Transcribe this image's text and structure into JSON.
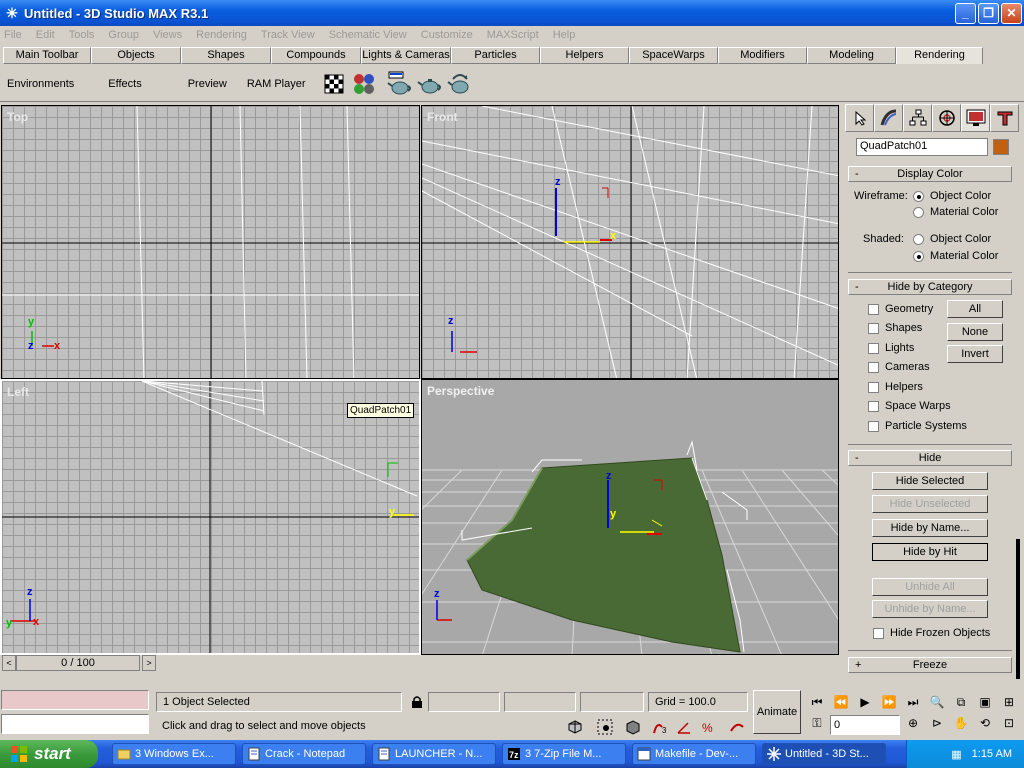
{
  "window": {
    "title": "Untitled - 3D Studio MAX R3.1",
    "minimize": "_",
    "restore": "❐",
    "close": "✕"
  },
  "menu": [
    "File",
    "Edit",
    "Tools",
    "Group",
    "Views",
    "Rendering",
    "Track View",
    "Schematic View",
    "Customize",
    "MAXScript",
    "Help"
  ],
  "tabs": [
    "Main Toolbar",
    "Objects",
    "Shapes",
    "Compounds",
    "Lights & Cameras",
    "Particles",
    "Helpers",
    "SpaceWarps",
    "Modifiers",
    "Modeling",
    "Rendering"
  ],
  "active_tab": "Rendering",
  "toolbar": {
    "environments": "Environments",
    "effects": "Effects",
    "preview": "Preview",
    "ram_player": "RAM Player"
  },
  "viewports": {
    "top": "Top",
    "front": "Front",
    "left": "Left",
    "perspective": "Perspective",
    "tooltip": "QuadPatch01",
    "axis_x": "x",
    "axis_y": "y",
    "axis_z": "z"
  },
  "panel": {
    "object_name": "QuadPatch01",
    "object_color": "#c06010",
    "display_color": {
      "title": "Display Color",
      "wireframe_label": "Wireframe:",
      "shaded_label": "Shaded:",
      "object_color": "Object Color",
      "material_color": "Material Color"
    },
    "hide_by_category": {
      "title": "Hide by Category",
      "items": [
        "Geometry",
        "Shapes",
        "Lights",
        "Cameras",
        "Helpers",
        "Space Warps",
        "Particle Systems"
      ],
      "all": "All",
      "none": "None",
      "invert": "Invert"
    },
    "hide": {
      "title": "Hide",
      "hide_selected": "Hide Selected",
      "hide_unselected": "Hide Unselected",
      "hide_by_name": "Hide by Name...",
      "hide_by_hit": "Hide by Hit",
      "unhide_all": "Unhide All",
      "unhide_by_name": "Unhide by Name...",
      "hide_frozen": "Hide Frozen Objects"
    },
    "freeze": {
      "title": "Freeze"
    },
    "minus": "-",
    "plus": "+"
  },
  "timeslider": {
    "frame": "0 / 100"
  },
  "status": {
    "selected": "1 Object Selected",
    "prompt": "Click and drag to select and move objects",
    "grid": "Grid = 100.0",
    "animate": "Animate",
    "frame_value": "0"
  },
  "taskbar": {
    "start": "start",
    "tasks": [
      "3 Windows Ex...",
      "Crack - Notepad",
      "LAUNCHER - N...",
      "3 7-Zip File M...",
      "Makefile - Dev-...",
      "Untitled - 3D St..."
    ],
    "time": "1:15 AM"
  },
  "colors": {
    "viewport_bg": "#c0c0c0",
    "patch_green": "#4a6a35",
    "axis_x": "#e00000",
    "axis_y": "#00c000",
    "axis_z": "#0000e0"
  }
}
